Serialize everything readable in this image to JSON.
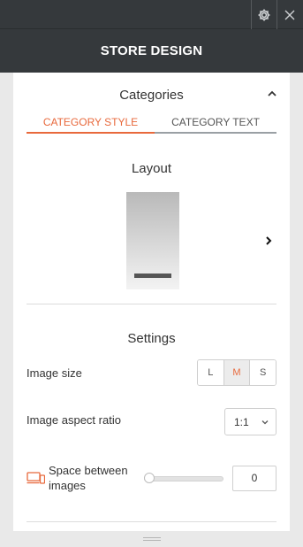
{
  "app": {
    "title": "STORE DESIGN",
    "top_buttons": {
      "settings_icon": "gear-icon",
      "close_icon": "close-icon"
    }
  },
  "categories": {
    "title": "Categories",
    "collapse_icon": "chevron-up-icon",
    "tabs": [
      {
        "label": "CATEGORY STYLE",
        "active": true
      },
      {
        "label": "CATEGORY TEXT",
        "active": false
      }
    ]
  },
  "layout": {
    "title": "Layout",
    "next_icon": "chevron-right-icon"
  },
  "settings": {
    "title": "Settings",
    "image_size": {
      "label": "Image size",
      "options": [
        "L",
        "M",
        "S"
      ],
      "selected": "M"
    },
    "aspect_ratio": {
      "label": "Image aspect ratio",
      "value": "1:1"
    },
    "spacing": {
      "icon": "devices-icon",
      "label": "Space between images",
      "value": "0",
      "slider_fraction": 0
    }
  },
  "colors": {
    "accent": "#e8693c",
    "header_bg": "#35393c"
  }
}
